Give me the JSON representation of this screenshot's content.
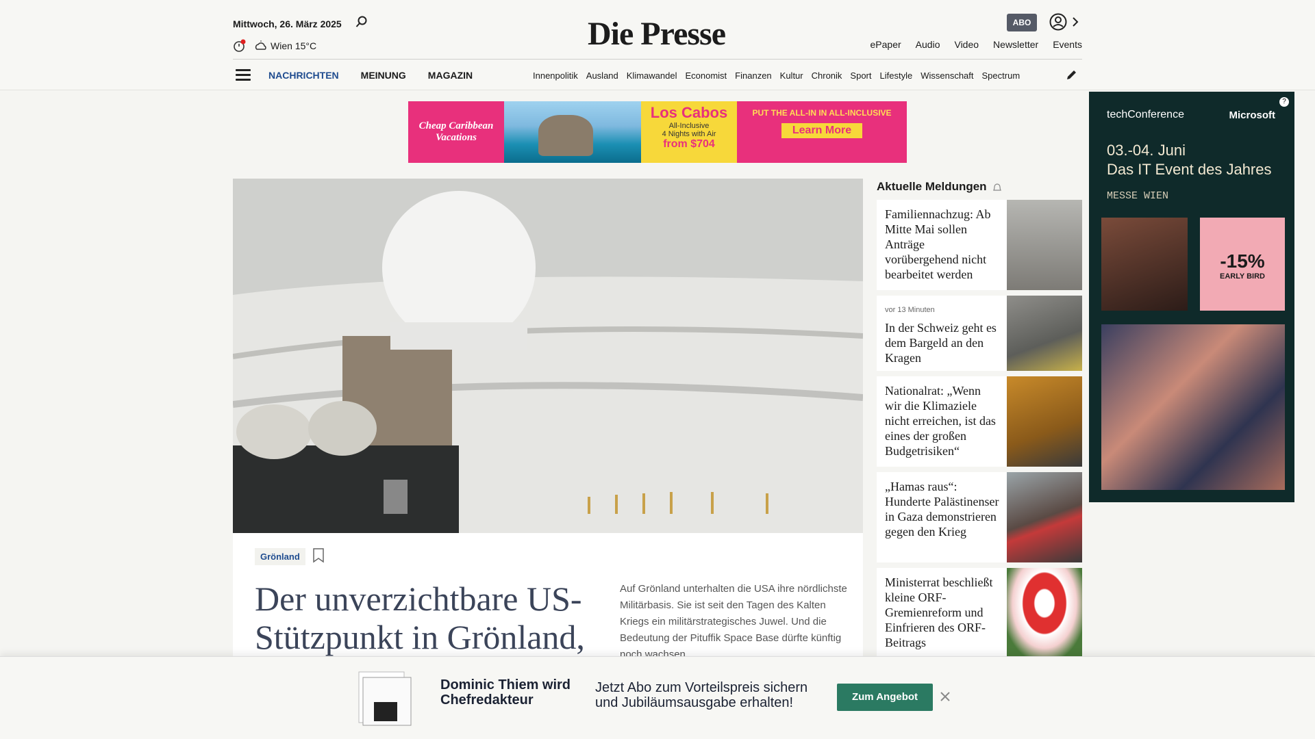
{
  "header": {
    "date": "Mittwoch, 26. März 2025",
    "weather": "Wien 15°C",
    "logo": "Die Presse",
    "abo": "ABO",
    "top_links": [
      "ePaper",
      "Audio",
      "Video",
      "Newsletter",
      "Events"
    ]
  },
  "nav": {
    "main": [
      "NACHRICHTEN",
      "MEINUNG",
      "MAGAZIN"
    ],
    "sections": [
      "Innenpolitik",
      "Ausland",
      "Klimawandel",
      "Economist",
      "Finanzen",
      "Kultur",
      "Chronik",
      "Sport",
      "Lifestyle",
      "Wissenschaft",
      "Spectrum"
    ]
  },
  "ad_top": {
    "brand": "Cheap Caribbean Vacations",
    "title": "Los Cabos",
    "sub": "All-Inclusive",
    "nights": "4 Nights with Air",
    "price": "from $704",
    "claim": "PUT THE ALL-IN IN ALL-INCLUSIVE",
    "cta": "Learn More"
  },
  "article": {
    "tag": "Grönland",
    "headline": "Der unverzichtbare US-Stützpunkt in Grönland,",
    "lead": "Auf Grönland unterhalten die USA ihre nördlichste Militärbasis. Sie ist seit den Tagen des Kalten Kriegs ein militärstrategisches Juwel. Und die Bedeutung der Pituffik Space Base dürfte künftig noch wachsen"
  },
  "news": {
    "title": "Aktuelle Meldungen",
    "items": [
      {
        "meta": "",
        "text": "Familiennachzug: Ab Mitte Mai sollen Anträge vorübergehend nicht bearbeitet werden"
      },
      {
        "meta": "vor 13 Minuten",
        "text": "In der Schweiz geht es dem Bargeld an den Kragen"
      },
      {
        "meta": "",
        "text": "Nationalrat: „Wenn wir die Klimaziele nicht erreichen, ist das eines der großen Budgetrisiken“"
      },
      {
        "meta": "",
        "text": "„Hamas raus“: Hunderte Palästinenser in Gaza demonstrieren gegen den Krieg"
      },
      {
        "meta": "",
        "text": "Ministerrat beschließt kleine ORF-Gremienreform und Einfrieren des ORF-Beitrags"
      }
    ]
  },
  "ad_right": {
    "brand": "techConference",
    "partner": "Microsoft",
    "dates": "03.-04. Juni",
    "tagline": "Das IT Event des Jahres",
    "location": "MESSE WIEN",
    "discount": "-15%",
    "discount_label": "EARLY BIRD"
  },
  "banner": {
    "name": "Dominic Thiem wird Chefredakteur",
    "text": "Jetzt Abo zum Vorteilspreis sichern und Jubiläumsausgabe erhalten!",
    "cta": "Zum Angebot"
  }
}
